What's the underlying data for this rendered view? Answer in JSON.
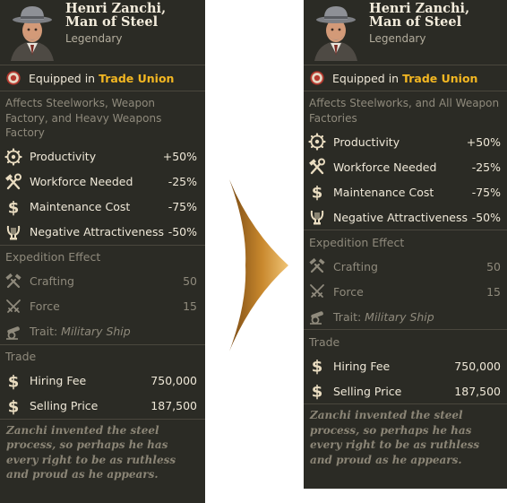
{
  "colors": {
    "panel_bg": "#2b2b25",
    "accent_gold": "#f3b722",
    "text_light": "#efe8d8",
    "text_dim": "#8f8a7c",
    "arrow_gold": "#c7882f"
  },
  "before": {
    "name": "Henri Zanchi, Man of Steel",
    "rarity": "Legendary",
    "equipped_prefix": "Equipped in",
    "equipped_building": "Trade Union",
    "affects": "Affects Steelworks, Weapon Factory, and Heavy Weapons Factory",
    "stats": [
      {
        "icon": "gear-icon",
        "label": "Productivity",
        "value": "+50%"
      },
      {
        "icon": "hammer-wrench-icon",
        "label": "Workforce Needed",
        "value": "-25%"
      },
      {
        "icon": "dollar-icon",
        "label": "Maintenance Cost",
        "value": "-75%"
      },
      {
        "icon": "lyre-icon",
        "label": "Negative Attractiveness",
        "value": "-50%"
      }
    ],
    "expedition_title": "Expedition Effect",
    "expedition": [
      {
        "icon": "crafting-icon",
        "label": "Crafting",
        "value": "50"
      },
      {
        "icon": "crossed-swords-icon",
        "label": "Force",
        "value": "15"
      }
    ],
    "trait_label": "Trait:",
    "trait_value": "Military Ship",
    "trade_title": "Trade",
    "trade": [
      {
        "icon": "dollar-icon",
        "label": "Hiring Fee",
        "value": "750,000"
      },
      {
        "icon": "dollar-icon",
        "label": "Selling Price",
        "value": "187,500"
      }
    ],
    "flavor": "Zanchi invented the steel process, so perhaps he has every right to be as ruthless and proud as he appears."
  },
  "after": {
    "name": "Henri Zanchi, Man of Steel",
    "rarity": "Legendary",
    "equipped_prefix": "Equipped in",
    "equipped_building": "Trade Union",
    "affects": "Affects Steelworks, and All Weapon Factories",
    "stats": [
      {
        "icon": "gear-icon",
        "label": "Productivity",
        "value": "+50%"
      },
      {
        "icon": "hammer-wrench-icon",
        "label": "Workforce Needed",
        "value": "-25%"
      },
      {
        "icon": "dollar-icon",
        "label": "Maintenance Cost",
        "value": "-75%"
      },
      {
        "icon": "lyre-icon",
        "label": "Negative Attractiveness",
        "value": "-50%"
      }
    ],
    "expedition_title": "Expedition Effect",
    "expedition": [
      {
        "icon": "crafting-icon",
        "label": "Crafting",
        "value": "50"
      },
      {
        "icon": "crossed-swords-icon",
        "label": "Force",
        "value": "15"
      }
    ],
    "trait_label": "Trait:",
    "trait_value": "Military Ship",
    "trade_title": "Trade",
    "trade": [
      {
        "icon": "dollar-icon",
        "label": "Hiring Fee",
        "value": "750,000"
      },
      {
        "icon": "dollar-icon",
        "label": "Selling Price",
        "value": "187,500"
      }
    ],
    "flavor": "Zanchi invented the steel process, so perhaps he has every right to be as ruthless and proud as he appears."
  }
}
